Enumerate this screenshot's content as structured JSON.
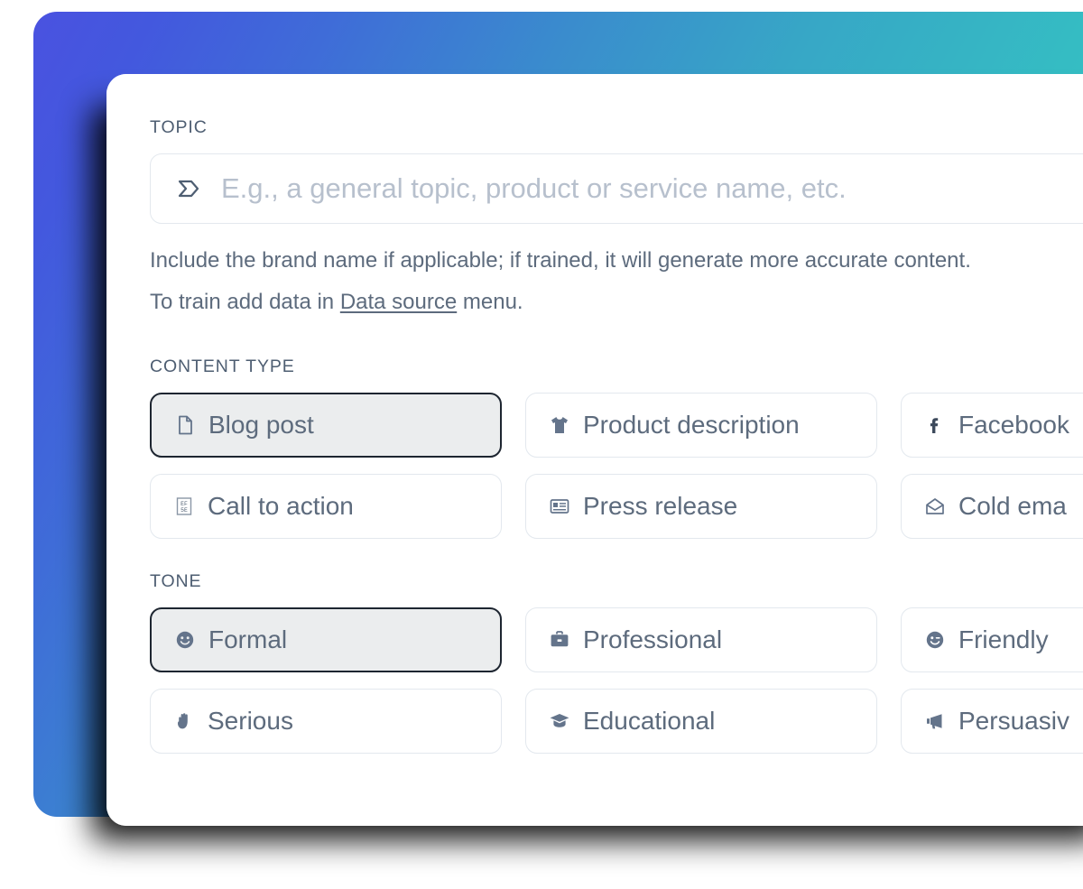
{
  "theme": {
    "gradient_start": "#4a52e0",
    "gradient_end": "#3bcbc1",
    "panel_bg": "#ffffff",
    "label_color": "#4e5e72",
    "text_color": "#5d6b7d",
    "placeholder_color": "#b7c0cd",
    "border_color": "#e3e8ee",
    "selected_border": "#1d2530",
    "selected_bg": "#ebedee"
  },
  "topic": {
    "label": "TOPIC",
    "icon": "sigma-arrow-icon",
    "placeholder": "E.g., a general topic, product or service name, etc.",
    "value": "",
    "helper_line1": "Include the brand name if applicable; if trained, it will generate more accurate content.",
    "helper_line2_before": "To train add data in ",
    "helper_link": "Data source",
    "helper_line2_after": " menu."
  },
  "content_type": {
    "label": "CONTENT TYPE",
    "options": [
      {
        "label": "Blog post",
        "icon": "file-document-icon",
        "selected": true
      },
      {
        "label": "Product description",
        "icon": "tshirt-icon",
        "selected": false
      },
      {
        "label": "Facebook",
        "icon": "facebook-f-icon",
        "selected": false
      },
      {
        "label": "Call to action",
        "icon": "glyph-box-icon",
        "selected": false
      },
      {
        "label": "Press release",
        "icon": "news-card-icon",
        "selected": false
      },
      {
        "label": "Cold ema",
        "icon": "open-envelope-icon",
        "selected": false
      }
    ]
  },
  "tone": {
    "label": "TONE",
    "options": [
      {
        "label": "Formal",
        "icon": "smiley-icon",
        "selected": true
      },
      {
        "label": "Professional",
        "icon": "briefcase-icon",
        "selected": false
      },
      {
        "label": "Friendly",
        "icon": "wink-smiley-icon",
        "selected": false
      },
      {
        "label": "Serious",
        "icon": "raised-hand-icon",
        "selected": false
      },
      {
        "label": "Educational",
        "icon": "graduation-cap-icon",
        "selected": false
      },
      {
        "label": "Persuasiv",
        "icon": "megaphone-icon",
        "selected": false
      }
    ]
  }
}
